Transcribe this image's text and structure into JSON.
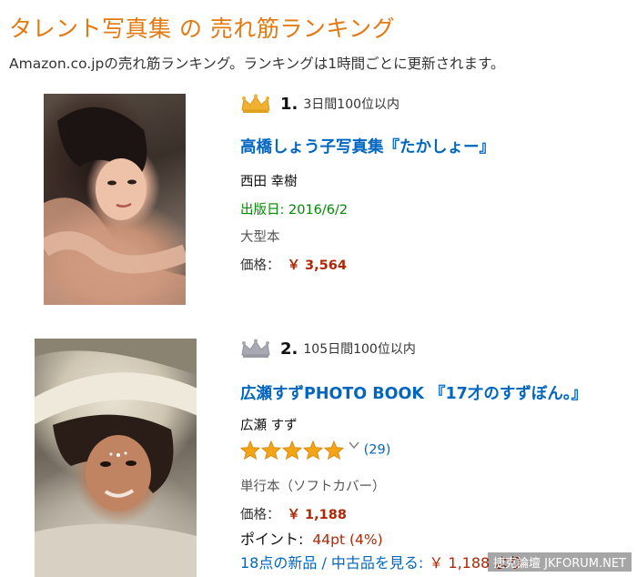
{
  "header": {
    "title": "タレント写真集 の 売れ筋ランキング",
    "subtitle": "Amazon.co.jpの売れ筋ランキング。ランキングは1時間ごとに更新されます。"
  },
  "items": [
    {
      "rank": "1.",
      "rank_days": "3日間100位以内",
      "crown": "gold-crown-icon",
      "title": "高橋しょう子写真集『たかしょー』",
      "author": "西田 幸樹",
      "release": "出版日: 2016/6/2",
      "format": "大型本",
      "price_label": "価格：",
      "price": "￥ 3,564"
    },
    {
      "rank": "2.",
      "rank_days": "105日間100位以内",
      "crown": "silver-crown-icon",
      "title": "広瀬すずPHOTO BOOK 『17才のすずぼん。』",
      "author": "広瀬 すず",
      "rating": 5,
      "review_count": "(29)",
      "format": "単行本（ソフトカバー）",
      "price_label": "価格：",
      "price": "￥ 1,188",
      "points_label": "ポイント:",
      "points": "44pt (4%)",
      "used_link": "18点の新品 / 中古品を見る:",
      "used_price": "￥ 1,188 より"
    }
  ],
  "watermark": "捷克論壇 JKFORUM.NET",
  "colors": {
    "accent": "#e47911",
    "link": "#0066c0",
    "price": "#b12704",
    "date": "#008a00",
    "star": "#f4a417",
    "gold_crown": "#f0b030",
    "silver_crown": "#a9a9b4"
  }
}
